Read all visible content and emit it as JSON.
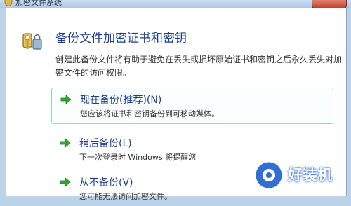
{
  "window": {
    "title": "加密文件系统"
  },
  "heading": "备份文件加密证书和密钥",
  "description": "创建此备份文件将有助于避免在丢失或损坏原始证书和密钥之后永久丢失对加密文件的访问权限。",
  "options": [
    {
      "title": "现在备份(推荐)(N)",
      "desc": "您应该将证书和密钥备份到可移动媒体。"
    },
    {
      "title": "稍后备份(L)",
      "desc": "下一次登录时 Windows 将提醒您"
    },
    {
      "title": "从不备份(V)",
      "desc": "您可能无法访问加密文件。"
    }
  ],
  "watermark": {
    "text": "好装机"
  },
  "colors": {
    "arrow": "#2eaa2e",
    "heading": "#1f3f8a",
    "selected_border": "#8fd3f0"
  },
  "icons": {
    "app": "shield-key-icon",
    "key": "key-lock-icon",
    "option": "green-arrow-icon"
  }
}
